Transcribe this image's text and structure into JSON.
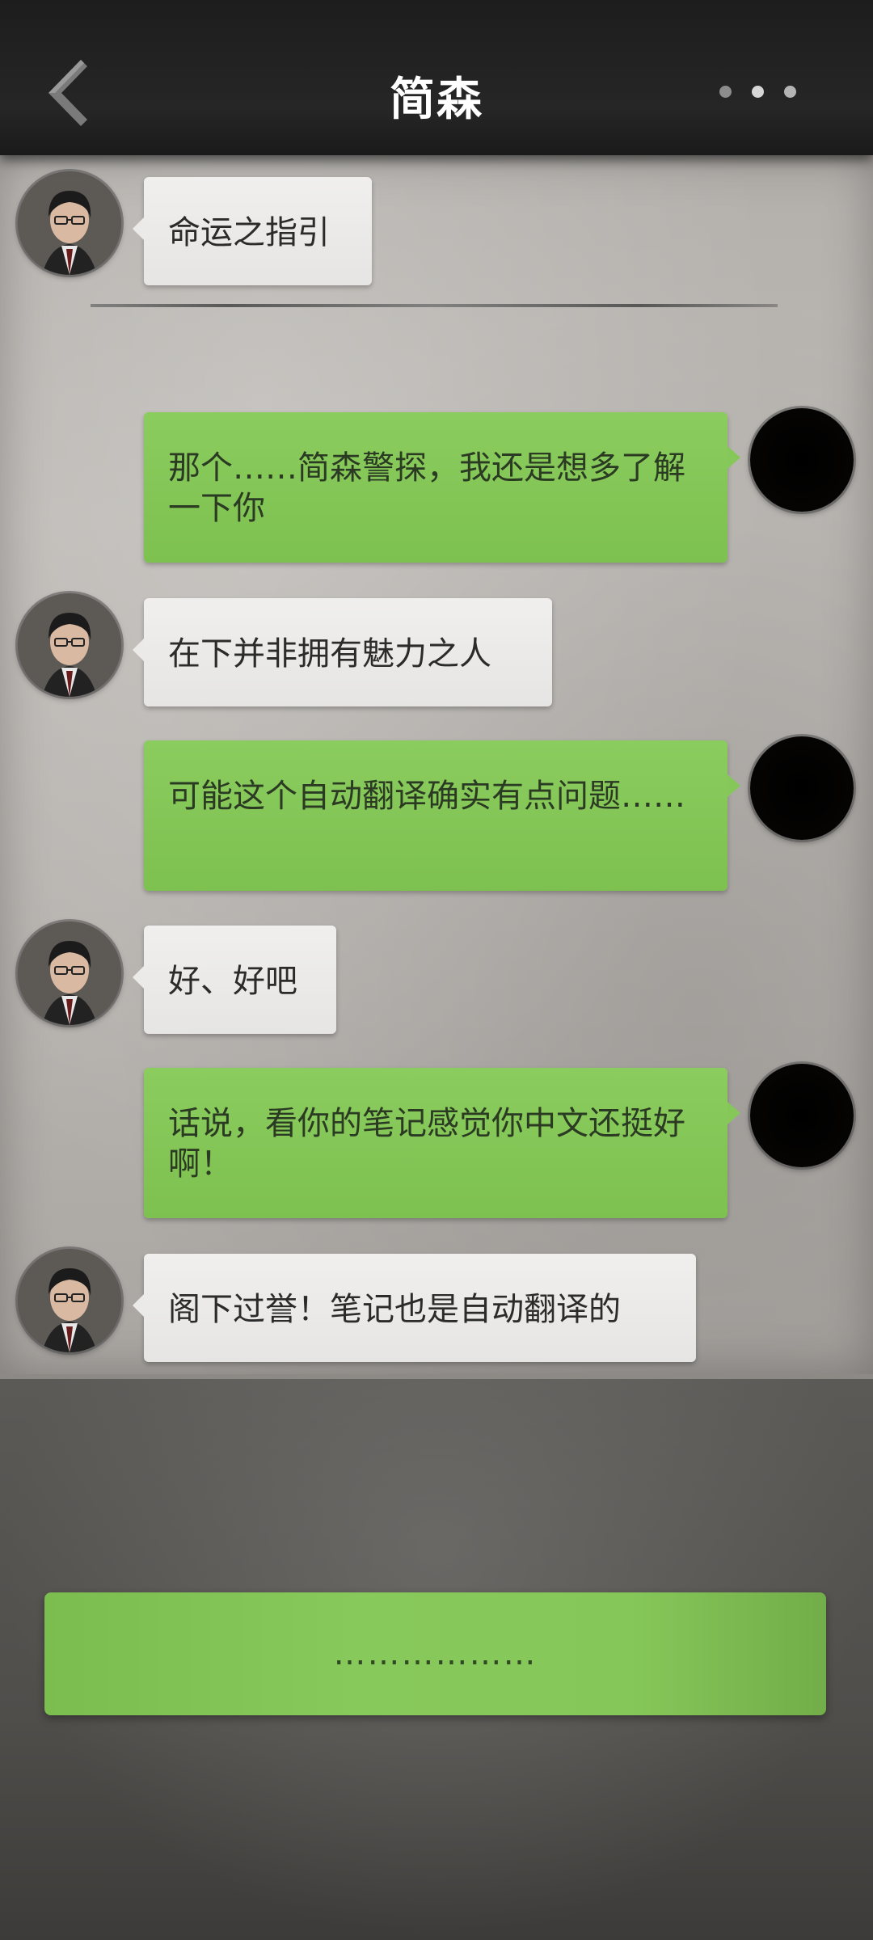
{
  "header": {
    "title": "简森"
  },
  "icons": {
    "back": "chevron-left-icon",
    "more": "more-dots-icon"
  },
  "colors": {
    "header_bg": "#222222",
    "paper_bg": "#b7b3af",
    "bubble_incoming": "#ecebe9",
    "bubble_outgoing": "#84c657",
    "choice_button": "#84c657"
  },
  "chat": {
    "messages": [
      {
        "sender": "简森",
        "side": "left",
        "text": "命运之指引"
      },
      {
        "sender": "player",
        "side": "right",
        "text": "那个……简森警探，我还是想多了解一下你"
      },
      {
        "sender": "简森",
        "side": "left",
        "text": "在下并非拥有魅力之人"
      },
      {
        "sender": "player",
        "side": "right",
        "text": "可能这个自动翻译确实有点问题……"
      },
      {
        "sender": "简森",
        "side": "left",
        "text": "好、好吧"
      },
      {
        "sender": "player",
        "side": "right",
        "text": "话说，看你的笔记感觉你中文还挺好啊！"
      },
      {
        "sender": "简森",
        "side": "left",
        "text": "阁下过誉！笔记也是自动翻译的"
      }
    ]
  },
  "choice": {
    "label": "………………"
  }
}
